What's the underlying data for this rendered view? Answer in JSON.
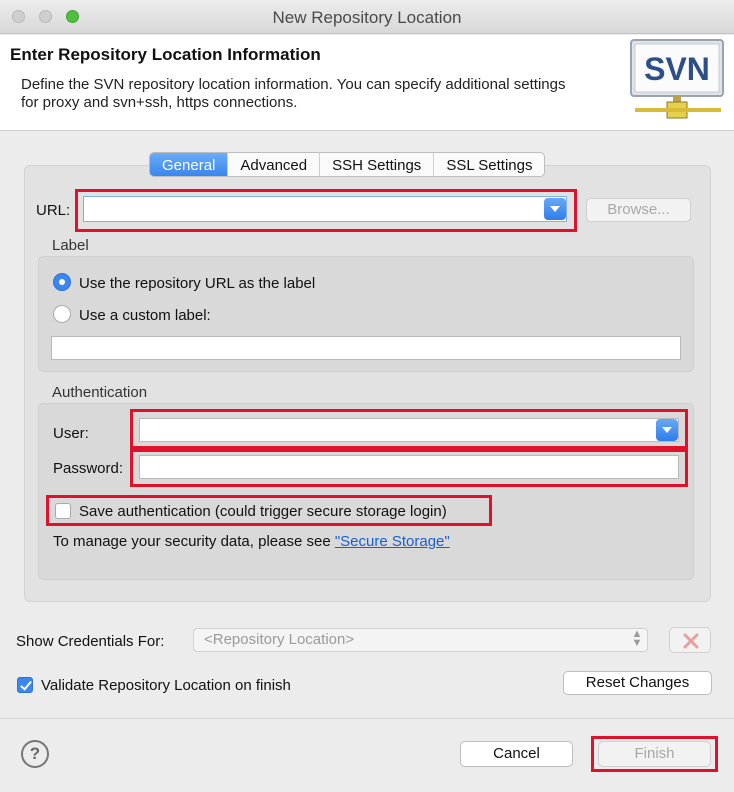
{
  "window": {
    "title": "New Repository Location"
  },
  "header": {
    "title": "Enter Repository Location Information",
    "description": "Define the SVN repository location information. You can specify additional settings for proxy and svn+ssh, https connections.",
    "logo_text": "SVN"
  },
  "tabs": [
    {
      "label": "General",
      "active": true
    },
    {
      "label": "Advanced",
      "active": false
    },
    {
      "label": "SSH Settings",
      "active": false
    },
    {
      "label": "SSL Settings",
      "active": false
    }
  ],
  "url": {
    "label": "URL:",
    "value": "",
    "browse_label": "Browse..."
  },
  "label_group": {
    "title": "Label",
    "option_repo_url": "Use the repository URL as the label",
    "option_custom": "Use a custom label:",
    "custom_value": "",
    "selected": "repository-url"
  },
  "auth_group": {
    "title": "Authentication",
    "user_label": "User:",
    "user_value": "",
    "password_label": "Password:",
    "password_value": "",
    "save_label": "Save authentication (could trigger secure storage login)",
    "save_checked": false,
    "manage_text": "To manage your security data, please see ",
    "manage_link": "\"Secure Storage\""
  },
  "credentials": {
    "label": "Show Credentials For:",
    "selected": "<Repository Location>"
  },
  "validate": {
    "label": "Validate Repository Location on finish",
    "checked": true
  },
  "buttons": {
    "reset": "Reset Changes",
    "cancel": "Cancel",
    "finish": "Finish"
  },
  "colors": {
    "accent": "#3b87ef",
    "highlight": "#e0112b"
  }
}
